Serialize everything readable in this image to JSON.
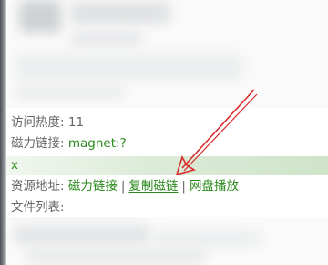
{
  "info": {
    "visits": {
      "label": "访问热度:",
      "value": "11"
    },
    "magnet": {
      "label": "磁力链接:",
      "value": "magnet:?"
    },
    "x_line": "x",
    "resource": {
      "label": "资源地址:",
      "links": [
        "磁力链接",
        "复制磁链",
        "网盘播放"
      ],
      "separator": "|"
    },
    "file_list": {
      "label": "文件列表:"
    }
  },
  "colors": {
    "link_green": "#2a8a1c",
    "label_gray": "#666666",
    "annotation_red": "#d92b2b"
  },
  "annotation": {
    "icon": "red-arrow-icon"
  }
}
